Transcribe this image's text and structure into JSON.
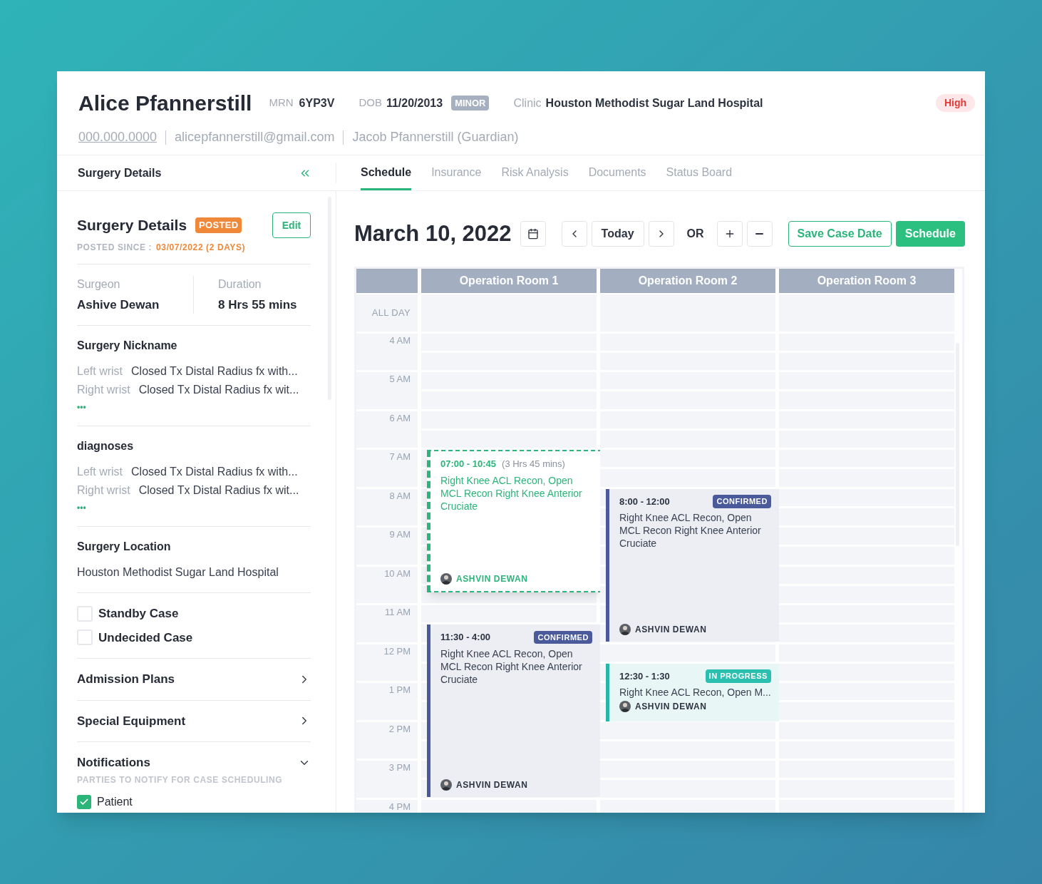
{
  "patient": {
    "name": "Alice Pfannerstill",
    "mrn_label": "MRN",
    "mrn": "6YP3V",
    "dob_label": "DOB",
    "dob": "11/20/2013",
    "age_badge": "MINOR",
    "clinic_label": "Clinic",
    "clinic": "Houston Methodist Sugar Land Hospital",
    "priority": "High",
    "phone": "000.000.0000",
    "email": "alicepfannerstill@gmail.com",
    "guardian": "Jacob Pfannerstill (Guardian)"
  },
  "sidebar_title": "Surgery Details",
  "tabs": [
    {
      "label": "Schedule",
      "selected": true
    },
    {
      "label": "Insurance",
      "selected": false
    },
    {
      "label": "Risk Analysis",
      "selected": false
    },
    {
      "label": "Documents",
      "selected": false
    },
    {
      "label": "Status Board",
      "selected": false
    }
  ],
  "details": {
    "title": "Surgery Details",
    "status_badge": "POSTED",
    "edit_button": "Edit",
    "posted_since_label": "POSTED SINCE :",
    "posted_since": "03/07/2022 (2 DAYS)",
    "surgeon_label": "Surgeon",
    "surgeon": "Ashive Dewan",
    "duration_label": "Duration",
    "duration": "8 Hrs 55 mins",
    "lists": [
      {
        "title": "Surgery Nickname",
        "more": "•••",
        "items": [
          {
            "side": "Left wrist",
            "text": "Closed Tx Distal Radius fx with..."
          },
          {
            "side": "Right wrist",
            "text": "Closed Tx Distal Radius fx wit..."
          }
        ]
      },
      {
        "title": "diagnoses",
        "more": "•••",
        "items": [
          {
            "side": "Left wrist",
            "text": "Closed Tx Distal Radius fx with..."
          },
          {
            "side": "Right wrist",
            "text": "Closed Tx Distal Radius fx wit..."
          }
        ]
      }
    ],
    "location_title": "Surgery Location",
    "location": "Houston Methodist Sugar Land Hospital",
    "checkboxes": [
      {
        "label": "Standby Case",
        "checked": false
      },
      {
        "label": "Undecided Case",
        "checked": false
      }
    ],
    "sections": [
      {
        "title": "Admission Plans",
        "expanded": false
      },
      {
        "title": "Special Equipment",
        "expanded": false
      },
      {
        "title": "Notifications",
        "expanded": true,
        "subtitle": "PARTIES TO NOTIFY FOR CASE SCHEDULING",
        "options": [
          {
            "label": "Patient",
            "checked": true
          }
        ]
      }
    ]
  },
  "toolbar": {
    "date": "March 10, 2022",
    "today": "Today",
    "or": "OR",
    "save_case_date": "Save Case Date",
    "schedule": "Schedule"
  },
  "calendar": {
    "all_day": "ALL DAY",
    "hours": [
      "4 AM",
      "5 AM",
      "6 AM",
      "7 AM",
      "8 AM",
      "9 AM",
      "10 AM",
      "11 AM",
      "12 PM",
      "1 PM",
      "2 PM",
      "3 PM",
      "4 PM"
    ],
    "rooms": [
      {
        "name": "Operation Room 1",
        "events": [
          {
            "kind": "draft",
            "time": "07:00 - 10:45",
            "duration": "(3 Hrs 45 mins)",
            "title": "Right Knee ACL Recon, Open MCL Recon Right Knee Anterior Cruciate",
            "surgeon": "ASHVIN DEWAN"
          },
          {
            "kind": "confirmed",
            "time": "11:30 - 4:00",
            "status": "CONFIRMED",
            "title": "Right Knee ACL Recon, Open MCL Recon Right Knee Anterior Cruciate",
            "surgeon": "ASHVIN DEWAN"
          }
        ]
      },
      {
        "name": "Operation Room 2",
        "events": [
          {
            "kind": "confirmed",
            "time": "8:00 - 12:00",
            "status": "CONFIRMED",
            "title": "Right Knee ACL Recon, Open MCL Recon Right Knee Anterior Cruciate",
            "surgeon": "ASHVIN DEWAN"
          },
          {
            "kind": "in_progress",
            "time": "12:30 - 1:30",
            "status": "IN PROGRESS",
            "title": "Right Knee ACL Recon, Open M...",
            "surgeon": "ASHVIN DEWAN"
          }
        ]
      },
      {
        "name": "Operation Room 3"
      }
    ]
  }
}
